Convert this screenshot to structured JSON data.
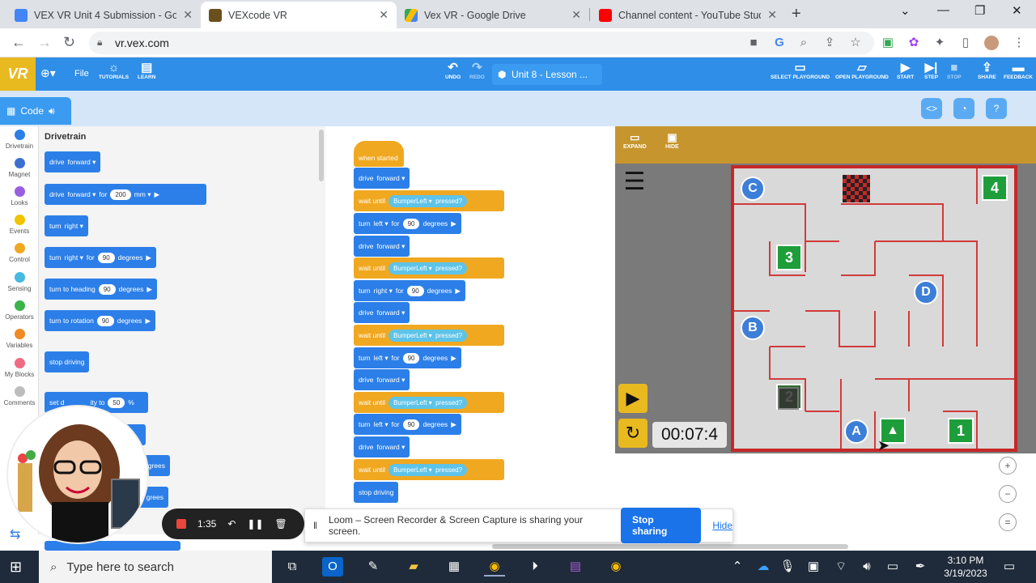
{
  "browser": {
    "tabs": [
      {
        "title": "VEX VR Unit 4 Submission - Goo",
        "color": "#4285f4"
      },
      {
        "title": "VEXcode VR",
        "color": "#6b4f1d"
      },
      {
        "title": "Vex VR - Google Drive",
        "color": "#34a853"
      },
      {
        "title": "Channel content - YouTube Studi",
        "color": "#ff0000"
      }
    ],
    "url": "vr.vex.com"
  },
  "vex": {
    "logo": "VR",
    "file": "File",
    "tutorials": "TUTORIALS",
    "learn": "LEARN",
    "undo": "UNDO",
    "redo": "REDO",
    "project": "Unit 8 - Lesson ...",
    "select_playground": "SELECT PLAYGROUND",
    "open_playground": "OPEN PLAYGROUND",
    "start": "START",
    "step": "STEP",
    "stop": "STOP",
    "share": "SHARE",
    "feedback": "FEEDBACK",
    "code_tab": "Code"
  },
  "categories": [
    {
      "label": "Drivetrain",
      "color": "#2c7fe8"
    },
    {
      "label": "Magnet",
      "color": "#3b6fd1"
    },
    {
      "label": "Looks",
      "color": "#9a5fe0"
    },
    {
      "label": "Events",
      "color": "#f2c300"
    },
    {
      "label": "Control",
      "color": "#f0a821"
    },
    {
      "label": "Sensing",
      "color": "#45b9e0"
    },
    {
      "label": "Operators",
      "color": "#3cb44b"
    },
    {
      "label": "Variables",
      "color": "#f08a24"
    },
    {
      "label": "My Blocks",
      "color": "#f06a84"
    },
    {
      "label": "Comments",
      "color": "#bdbdbd"
    }
  ],
  "palette": {
    "title": "Drivetrain",
    "b_drive": "drive",
    "b_forward": "forward",
    "b_for": "for",
    "b_200": "200",
    "b_mm": "mm",
    "b_turn": "turn",
    "b_right": "right",
    "b_90": "90",
    "b_degrees": "degrees",
    "b_turn_heading": "turn to heading",
    "b_turn_rotation": "turn to rotation",
    "b_stop": "stop driving",
    "b_velocity_pre": "set d",
    "b_velocity_post": "ity to",
    "b_50": "50",
    "b_pct": "%",
    "b_degrees2": "grees",
    "b_degrees3": "grees"
  },
  "script": {
    "when_started": "when started",
    "drive": "drive",
    "forward": "forward",
    "wait_until": "wait until",
    "bumper": "BumperLeft",
    "pressed": "pressed?",
    "turn": "turn",
    "left": "left",
    "right": "right",
    "for": "for",
    "ninety": "90",
    "degrees": "degrees",
    "stop_driving": "stop driving"
  },
  "playground": {
    "expand": "EXPAND",
    "hide": "HIDE",
    "timer": "00:07:4",
    "markers": {
      "c": "C",
      "b": "B",
      "d": "D",
      "a": "A",
      "n4": "4",
      "n3": "3",
      "n2": "2",
      "n1": "1"
    }
  },
  "loom": {
    "time": "1:35",
    "message": "Loom – Screen Recorder & Screen Capture is sharing your screen.",
    "stop": "Stop sharing",
    "hide": "Hide"
  },
  "taskbar": {
    "search": "Type here to search",
    "time": "3:10 PM",
    "date": "3/19/2023"
  }
}
